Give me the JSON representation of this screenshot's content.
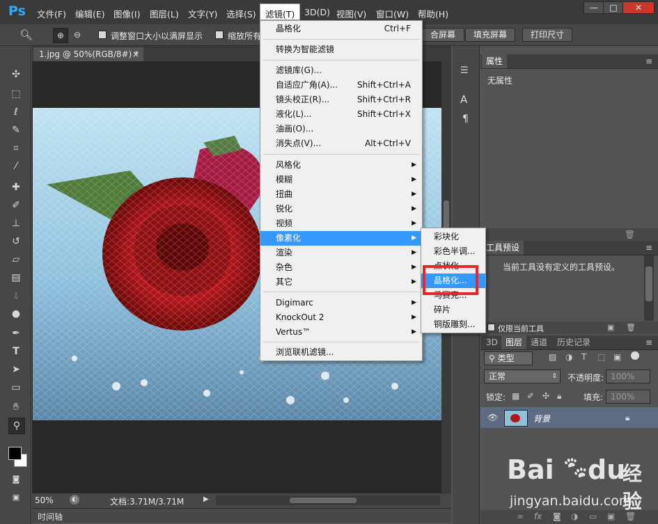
{
  "app": {
    "logo": "Ps"
  },
  "menubar": {
    "items": [
      "文件(F)",
      "编辑(E)",
      "图像(I)",
      "图层(L)",
      "文字(Y)",
      "选择(S)",
      "滤镜(T)",
      "3D(D)",
      "视图(V)",
      "窗口(W)",
      "帮助(H)"
    ],
    "win_min": "—",
    "win_max": "□",
    "win_close": "✕"
  },
  "options": {
    "resize_label": "调整窗口大小以满屏显示",
    "zoom_all_label": "缩放所有",
    "fit_screen": "合屏幕",
    "fill_screen": "填充屏幕",
    "print_size": "打印尺寸"
  },
  "document": {
    "tab_title": "1.jpg @ 50%(RGB/8#) *",
    "tab_close": "×"
  },
  "status": {
    "zoom": "50%",
    "doc_info": "文档:3.71M/3.71M",
    "timeline": "时间轴"
  },
  "filter_menu": {
    "last_filter": "晶格化",
    "last_filter_shortcut": "Ctrl+F",
    "smart": "转换为智能滤镜",
    "items_group2": [
      {
        "label": "滤镜库(G)...",
        "shortcut": ""
      },
      {
        "label": "自适应广角(A)...",
        "shortcut": "Shift+Ctrl+A"
      },
      {
        "label": "镜头校正(R)...",
        "shortcut": "Shift+Ctrl+R"
      },
      {
        "label": "液化(L)...",
        "shortcut": "Shift+Ctrl+X"
      },
      {
        "label": "油画(O)...",
        "shortcut": ""
      },
      {
        "label": "消失点(V)...",
        "shortcut": "Alt+Ctrl+V"
      }
    ],
    "items_group3": [
      "风格化",
      "模糊",
      "扭曲",
      "锐化",
      "视频",
      "像素化",
      "渲染",
      "杂色",
      "其它"
    ],
    "items_group4": [
      "Digimarc",
      "KnockOut 2",
      "Vertus™"
    ],
    "browse": "浏览联机滤镜..."
  },
  "pixelate_submenu": {
    "items": [
      "彩块化",
      "彩色半调...",
      "点状化",
      "晶格化...",
      "马赛克...",
      "碎片",
      "铜版雕刻..."
    ],
    "highlight_index": 3
  },
  "properties_panel": {
    "title": "属性",
    "empty_text": "无属性"
  },
  "tool_presets_panel": {
    "title": "工具预设",
    "empty_text": "当前工具没有定义的工具预设。",
    "current_only_label": "仅限当前工具"
  },
  "layers_panel": {
    "tabs": [
      "3D",
      "图层",
      "通道",
      "历史记录"
    ],
    "active_tab": "图层",
    "filter_kind": "类型",
    "blend_mode": "正常",
    "opacity_label": "不透明度:",
    "opacity_value": "100%",
    "lock_label": "锁定:",
    "fill_label": "填充:",
    "fill_value": "100%",
    "layer_name": "背景"
  },
  "watermark": {
    "brand": "Bai",
    "brand2": "du",
    "brand3": "经验",
    "url": "jingyan.baidu.com"
  },
  "colors": {
    "accent": "#3399ff",
    "highlight_box": "#e8262b",
    "ps_blue": "#31a8ff"
  }
}
